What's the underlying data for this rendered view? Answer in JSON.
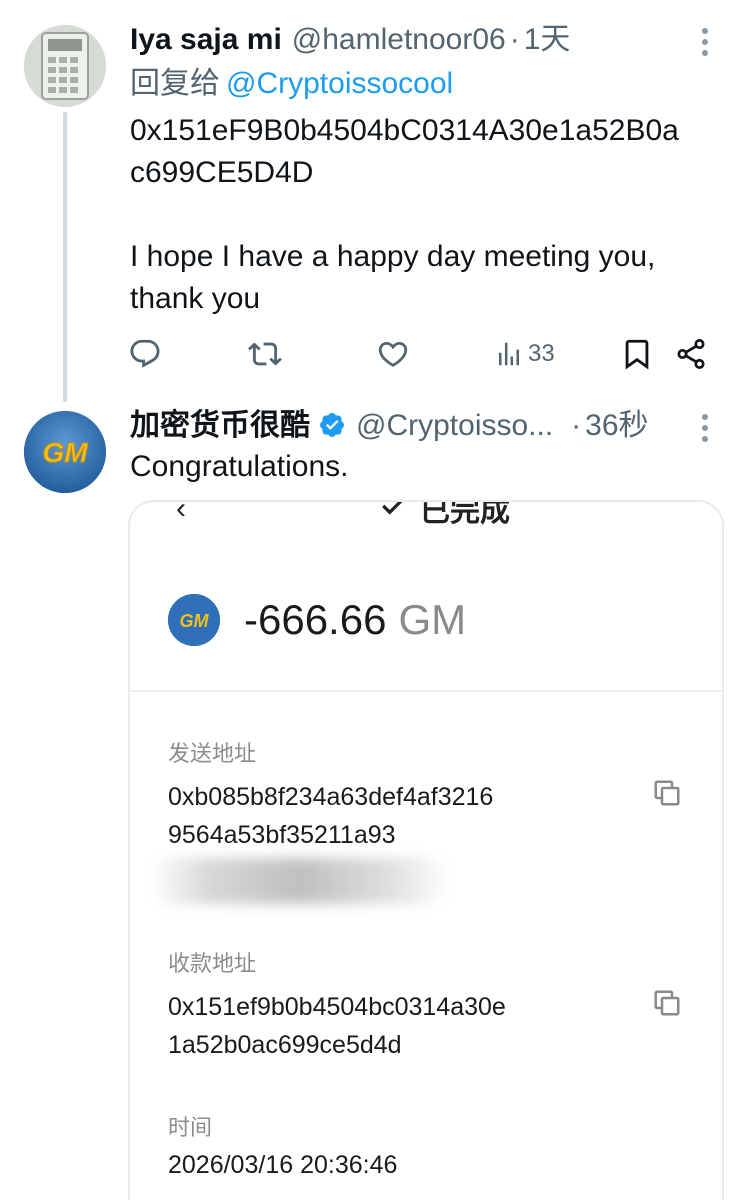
{
  "tweet1": {
    "display_name": "Iya saja mi",
    "handle": "@hamletnoor06",
    "separator": "·",
    "time": "1天",
    "reply_prefix": "回复给",
    "reply_mention": "@Cryptoissocool",
    "text_line1": "0x151eF9B0b4504bC0314A30e1a52B0a",
    "text_line2": "c699CE5D4D",
    "text_line3": "I hope I have a happy day meeting you,",
    "text_line4": "thank you",
    "actions": {
      "views_count": "33"
    }
  },
  "tweet2": {
    "display_name": "加密货币很酷",
    "handle": "@Cryptoisso...",
    "separator": "·",
    "time": "36秒",
    "text": "Congratulations.",
    "avatar_text": "GM"
  },
  "media": {
    "status_title": "已完成",
    "amount_sign_value": "-666.66",
    "amount_unit": "GM",
    "token_logo_text": "GM",
    "send_label": "发送地址",
    "send_line1": "0xb085b8f234a63def4af3216",
    "send_line2": "9564a53bf35211a93",
    "receive_label": "收款地址",
    "receive_line1": "0x151ef9b0b4504bc0314a30e",
    "receive_line2": "1a52b0ac699ce5d4d",
    "time_label": "时间",
    "time_value": "2026/03/16 20:36:46"
  },
  "colors": {
    "accent": "#1d9bf0",
    "muted": "#536471",
    "verified": "#1d9bf0"
  }
}
